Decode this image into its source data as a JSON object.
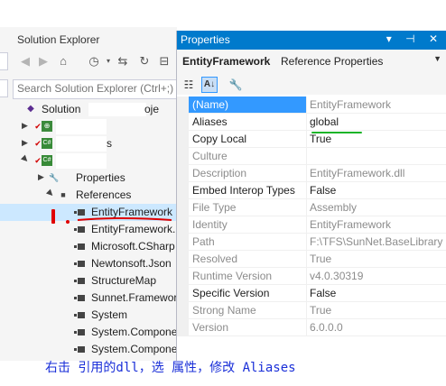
{
  "solution_explorer": {
    "title": "Solution Explorer",
    "search_placeholder": "Search Solution Explorer (Ctrl+;)",
    "tree": {
      "solution_label": "Solution",
      "solution_suffix": "oje",
      "project2_suffix": "s",
      "properties_label": "Properties",
      "references_label": "References",
      "references": [
        "EntityFramework",
        "EntityFramework.SqlServer",
        "Microsoft.CSharp",
        "Newtonsoft.Json",
        "StructureMap",
        "Sunnet.Framework",
        "System",
        "System.ComponentModel",
        "System.ComponentModel.DataAnnotations"
      ]
    }
  },
  "properties": {
    "title": "Properties",
    "title_buttons": "▾ ⊣ ✕",
    "object_name": "EntityFramework",
    "object_type": "Reference Properties",
    "rows": [
      {
        "name": "(Name)",
        "value": "EntityFramework",
        "readonly": true
      },
      {
        "name": "Aliases",
        "value": "global",
        "readonly": false
      },
      {
        "name": "Copy Local",
        "value": "True",
        "readonly": false
      },
      {
        "name": "Culture",
        "value": "",
        "readonly": true
      },
      {
        "name": "Description",
        "value": "EntityFramework.dll",
        "readonly": true
      },
      {
        "name": "Embed Interop Types",
        "value": "False",
        "readonly": false
      },
      {
        "name": "File Type",
        "value": "Assembly",
        "readonly": true
      },
      {
        "name": "Identity",
        "value": "EntityFramework",
        "readonly": true
      },
      {
        "name": "Path",
        "value": "F:\\TFS\\SunNet.BaseLibrary",
        "readonly": true
      },
      {
        "name": "Resolved",
        "value": "True",
        "readonly": true
      },
      {
        "name": "Runtime Version",
        "value": "v4.0.30319",
        "readonly": true
      },
      {
        "name": "Specific Version",
        "value": "False",
        "readonly": false
      },
      {
        "name": "Strong Name",
        "value": "True",
        "readonly": true
      },
      {
        "name": "Version",
        "value": "6.0.0.0",
        "readonly": true
      }
    ]
  },
  "caption": "右击 引用的dll，选 属性，修改 Aliases",
  "colors": {
    "accent": "#007acc",
    "selection": "#cce8ff",
    "annotation_red": "#e00000",
    "annotation_green": "#19b428",
    "caption": "#1a2fd8"
  }
}
